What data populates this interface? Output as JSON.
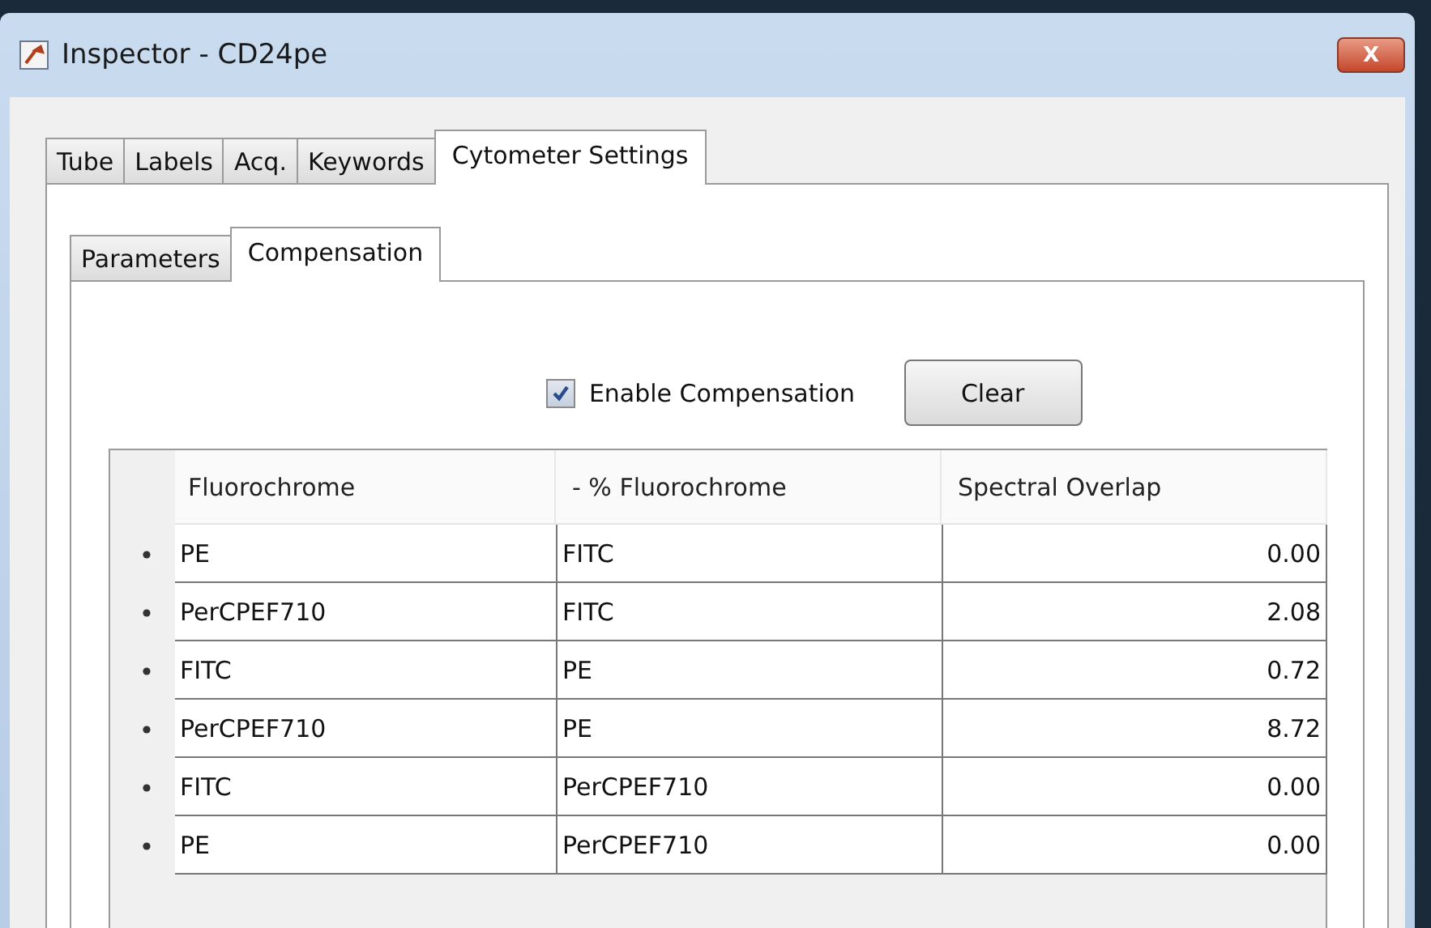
{
  "window": {
    "title": "Inspector - CD24pe",
    "close_label": "X"
  },
  "tabs": [
    {
      "label": "Tube",
      "selected": false
    },
    {
      "label": "Labels",
      "selected": false
    },
    {
      "label": "Acq.",
      "selected": false
    },
    {
      "label": "Keywords",
      "selected": false
    },
    {
      "label": "Cytometer Settings",
      "selected": true
    }
  ],
  "subtabs": [
    {
      "label": "Parameters",
      "selected": false
    },
    {
      "label": "Compensation",
      "selected": true
    }
  ],
  "enable_compensation": {
    "label": "Enable Compensation",
    "checked": true
  },
  "clear_button": "Clear",
  "table": {
    "columns": [
      "Fluorochrome",
      "- % Fluorochrome",
      "Spectral Overlap"
    ],
    "rows": [
      {
        "fluorochrome": "PE",
        "minus_fluorochrome": "FITC",
        "spectral_overlap": "0.00"
      },
      {
        "fluorochrome": "PerCPEF710",
        "minus_fluorochrome": "FITC",
        "spectral_overlap": "2.08"
      },
      {
        "fluorochrome": "FITC",
        "minus_fluorochrome": "PE",
        "spectral_overlap": "0.72"
      },
      {
        "fluorochrome": "PerCPEF710",
        "minus_fluorochrome": "PE",
        "spectral_overlap": "8.72"
      },
      {
        "fluorochrome": "FITC",
        "minus_fluorochrome": "PerCPEF710",
        "spectral_overlap": "0.00"
      },
      {
        "fluorochrome": "PE",
        "minus_fluorochrome": "PerCPEF710",
        "spectral_overlap": "0.00"
      }
    ]
  }
}
